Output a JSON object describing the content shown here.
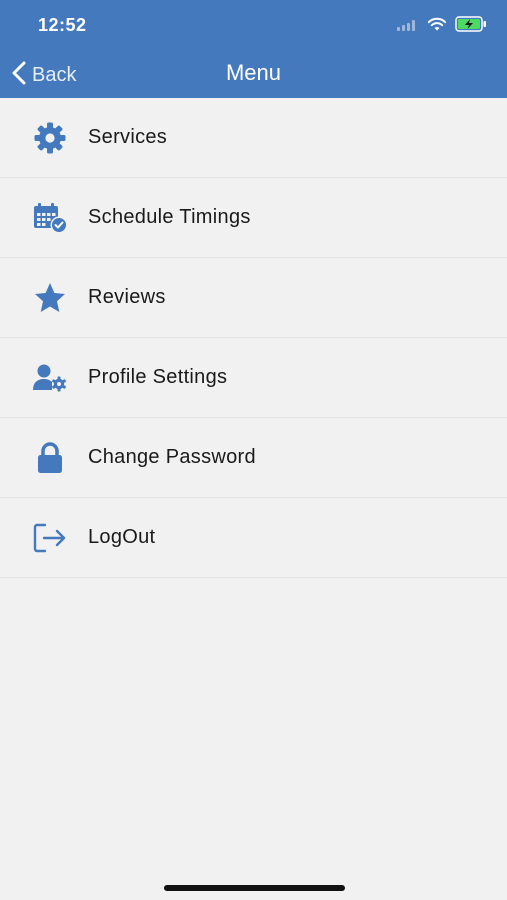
{
  "status_bar": {
    "time": "12:52"
  },
  "nav": {
    "back_label": "Back",
    "title": "Menu"
  },
  "menu": {
    "items": [
      {
        "label": "Services",
        "icon": "gear-icon"
      },
      {
        "label": "Schedule Timings",
        "icon": "calendar-check-icon"
      },
      {
        "label": "Reviews",
        "icon": "star-icon"
      },
      {
        "label": "Profile Settings",
        "icon": "user-cog-icon"
      },
      {
        "label": "Change Password",
        "icon": "lock-icon"
      },
      {
        "label": "LogOut",
        "icon": "logout-icon"
      }
    ]
  },
  "colors": {
    "accent": "#4479bd",
    "background": "#f1f1f1"
  }
}
